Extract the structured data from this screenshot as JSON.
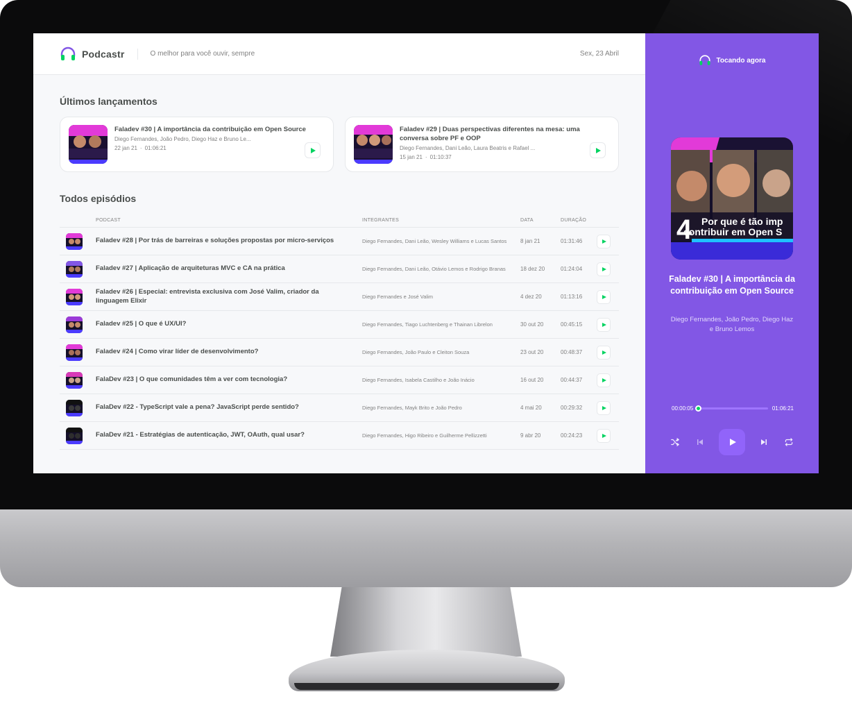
{
  "app": {
    "name": "Podcastr",
    "tagline": "O melhor para você ouvir, sempre",
    "date": "Sex, 23 Abril"
  },
  "latest": {
    "title": "Últimos lançamentos",
    "episodes": [
      {
        "title": "Faladev #30 | A importância da contribuição em Open Source",
        "members": "Diego Fernandes, João Pedro, Diego Haz e Bruno Le...",
        "date": "22 jan 21",
        "duration": "01:06:21"
      },
      {
        "title": "Faladev #29 | Duas perspectivas diferentes na mesa: uma conversa sobre PF e OOP",
        "members": "Diego Fernandes, Dani Leão, Laura Beatris e Rafael ...",
        "date": "15 jan 21",
        "duration": "01:10:37"
      }
    ]
  },
  "all_episodes": {
    "title": "Todos episódios",
    "columns": {
      "podcast": "PODCAST",
      "members": "INTEGRANTES",
      "date": "DATA",
      "duration": "DURAÇÃO"
    },
    "rows": [
      {
        "title": "Faladev #28 | Por trás de barreiras e soluções propostas por micro-serviços",
        "members": "Diego Fernandes, Dani Leão, Wesley Williams e Lucas Santos",
        "date": "8 jan 21",
        "duration": "01:31:46"
      },
      {
        "title": "Faladev #27 | Aplicação de arquiteturas MVC e CA na prática",
        "members": "Diego Fernandes, Dani Leão, Otávio Lemos e Rodrigo Branas",
        "date": "18 dez 20",
        "duration": "01:24:04"
      },
      {
        "title": "Faladev #26 | Especial: entrevista exclusiva com José Valim, criador da linguagem Elixir",
        "members": "Diego Fernandes e José Valim",
        "date": "4 dez 20",
        "duration": "01:13:16"
      },
      {
        "title": "Faladev #25 | O que é UX/UI?",
        "members": "Diego Fernandes, Tiago Luchtenberg e Thainan Librelon",
        "date": "30 out 20",
        "duration": "00:45:15"
      },
      {
        "title": "Faladev #24 | Como virar líder de desenvolvimento?",
        "members": "Diego Fernandes, João Paulo e Cleiton Souza",
        "date": "23 out 20",
        "duration": "00:48:37"
      },
      {
        "title": "FalaDev #23 | O que comunidades têm a ver com tecnologia?",
        "members": "Diego Fernandes, Isabela Castilho e João Inácio",
        "date": "16 out 20",
        "duration": "00:44:37"
      },
      {
        "title": "FalaDev #22 - TypeScript vale a pena? JavaScript perde sentido?",
        "members": "Diego Fernandes, Mayk Brito e João Pedro",
        "date": "4 mai 20",
        "duration": "00:29:32"
      },
      {
        "title": "FalaDev #21 - Estratégias de autenticação, JWT, OAuth, qual usar?",
        "members": "Diego Fernandes, Higo Ribeiro e Guilherme Pellizzetti",
        "date": "9 abr 20",
        "duration": "00:24:23"
      }
    ]
  },
  "player": {
    "label": "Tocando agora",
    "cover_text_line1": "Por que é tão imp",
    "cover_text_line2": "contribuir em Open S",
    "cover_number": "4",
    "episode_title": "Faladev #30 | A importância da contribuição em Open Source",
    "members": "Diego Fernandes, João Pedro, Diego Haz e Bruno Lemos",
    "current_time": "00:00:05",
    "total_time": "01:06:21",
    "progress_fraction": 0.008
  },
  "icons": {
    "logo": "headphones-icon",
    "player_header": "headphones-icon",
    "play": "play-icon",
    "shuffle": "shuffle-icon",
    "previous": "skip-previous-icon",
    "next": "skip-next-icon",
    "repeat": "repeat-icon"
  },
  "colors": {
    "brand_purple": "#8257e5",
    "accent_green": "#04d361",
    "text_dark": "#494d4b",
    "text_muted": "#808080",
    "background": "#f7f8fa"
  }
}
